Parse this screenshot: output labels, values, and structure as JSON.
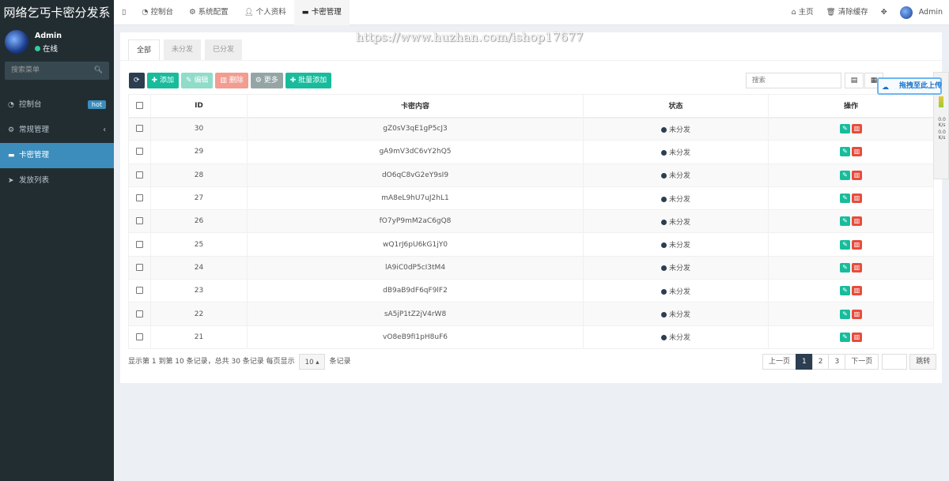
{
  "sidebar": {
    "brand": "网络乞丐卡密分发系",
    "user": {
      "name": "Admin",
      "status": "在线"
    },
    "search_placeholder": "搜索菜单",
    "menu": [
      {
        "label": "控制台",
        "icon": "dashboard-icon",
        "badge": "hot"
      },
      {
        "label": "常规管理",
        "icon": "cogs-icon",
        "caret": "‹"
      },
      {
        "label": "卡密管理",
        "icon": "credit-card-icon",
        "active": true
      },
      {
        "label": "发放列表",
        "icon": "send-icon"
      }
    ]
  },
  "topbar": {
    "toggle": "▯",
    "tabs": [
      {
        "label": "控制台",
        "icon": "dashboard-icon"
      },
      {
        "label": "系统配置",
        "icon": "gear-icon"
      },
      {
        "label": "个人资料",
        "icon": "user-icon"
      },
      {
        "label": "卡密管理",
        "icon": "credit-card-icon"
      }
    ],
    "right": {
      "home": "主页",
      "clear_cache": "清除缓存",
      "fullscreen": "✥",
      "user": "Admin"
    }
  },
  "watermark": "https://www.huzhan.com/ishop17677",
  "filter_tabs": [
    "全部",
    "未分发",
    "已分发"
  ],
  "toolbar": {
    "refresh": "⟳",
    "add": "添加",
    "edit": "编辑",
    "delete": "删除",
    "more": "更多",
    "batch_add": "批量添加",
    "search_placeholder": "搜索"
  },
  "table": {
    "columns": [
      "ID",
      "卡密内容",
      "状态",
      "操作"
    ],
    "rows": [
      {
        "id": "30",
        "content": "gZ0sV3qE1gP5cJ3",
        "status": "未分发"
      },
      {
        "id": "29",
        "content": "gA9mV3dC6vY2hQ5",
        "status": "未分发"
      },
      {
        "id": "28",
        "content": "dO6qC8vG2eY9sI9",
        "status": "未分发"
      },
      {
        "id": "27",
        "content": "mA8eL9hU7uJ2hL1",
        "status": "未分发"
      },
      {
        "id": "26",
        "content": "fO7yP9mM2aC6gQ8",
        "status": "未分发"
      },
      {
        "id": "25",
        "content": "wQ1rJ6pU6kG1jY0",
        "status": "未分发"
      },
      {
        "id": "24",
        "content": "lA9iC0dP5cI3tM4",
        "status": "未分发"
      },
      {
        "id": "23",
        "content": "dB9aB9dF6qF9lF2",
        "status": "未分发"
      },
      {
        "id": "22",
        "content": "sA5jP1tZ2jV4rW8",
        "status": "未分发"
      },
      {
        "id": "21",
        "content": "vO8eB9fI1pH8uF6",
        "status": "未分发"
      }
    ]
  },
  "pagination": {
    "info": "显示第 1 到第 10 条记录，总共 30 条记录 每页显示",
    "page_size": "10 ▴",
    "suffix": "条记录",
    "prev": "上一页",
    "pages": [
      "1",
      "2",
      "3"
    ],
    "next": "下一页",
    "jump": "跳转"
  },
  "upload_widget": {
    "label": "拖拽至此上传"
  },
  "float_bar": {
    "v1": "0.0",
    "u1": "K/s",
    "v2": "0.0",
    "u2": "K/s"
  }
}
